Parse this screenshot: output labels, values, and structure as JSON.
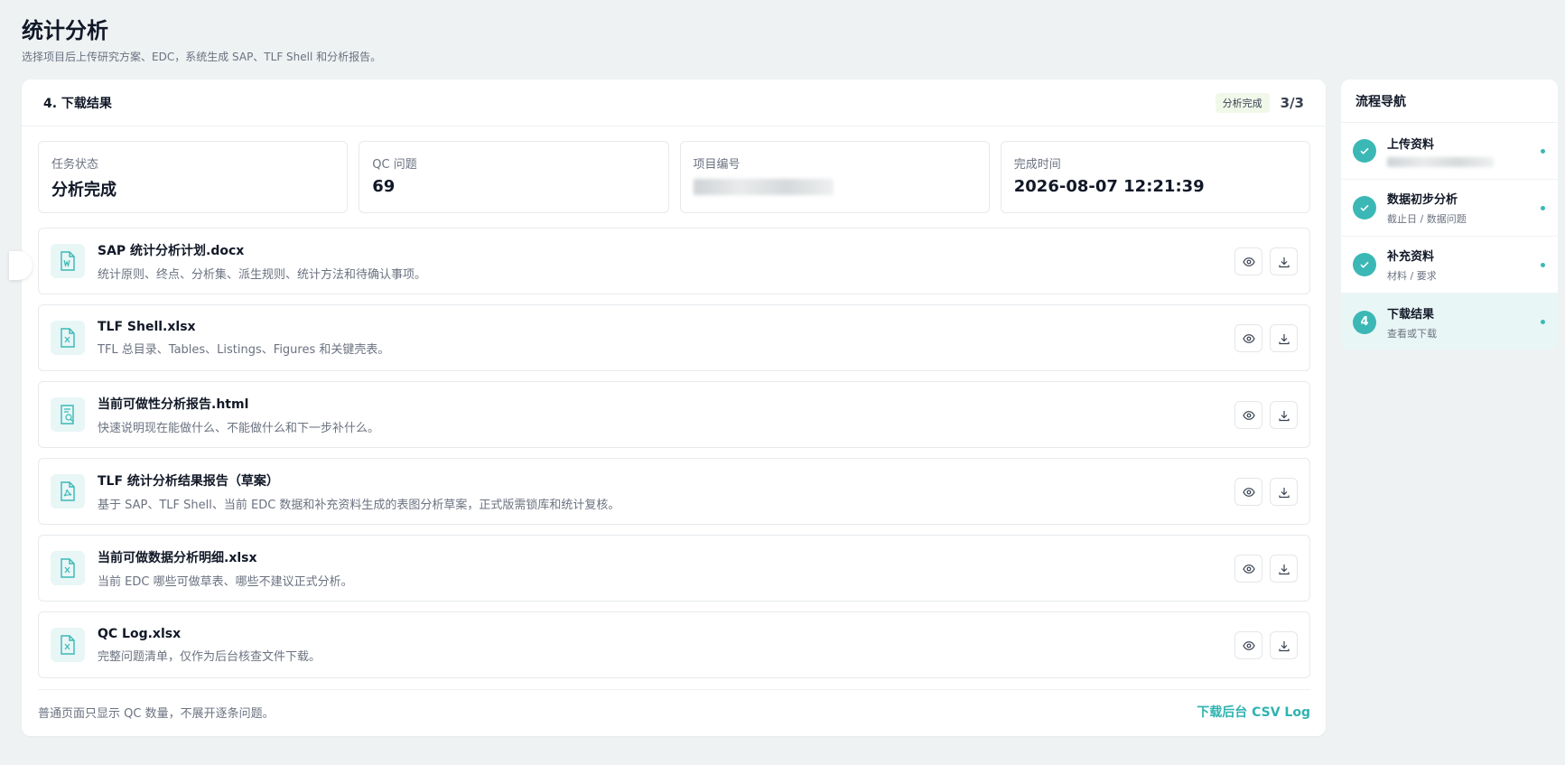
{
  "page": {
    "title": "统计分析",
    "subtitle": "选择项目后上传研究方案、EDC，系统生成 SAP、TLF Shell 和分析报告。"
  },
  "card": {
    "step_title": "4. 下载结果",
    "badge": "分析完成",
    "progress": "3/3"
  },
  "stats": [
    {
      "label": "任务状态",
      "value": "分析完成"
    },
    {
      "label": "QC 问题",
      "value": "69"
    },
    {
      "label": "项目编号",
      "value": ""
    },
    {
      "label": "完成时间",
      "value": "2026-08-07 12:21:39"
    }
  ],
  "files": [
    {
      "name": "SAP 统计分析计划.docx",
      "desc": "统计原则、终点、分析集、派生规则、统计方法和待确认事项。",
      "icon": "word-file-icon"
    },
    {
      "name": "TLF Shell.xlsx",
      "desc": "TFL 总目录、Tables、Listings、Figures 和关键壳表。",
      "icon": "excel-file-icon"
    },
    {
      "name": "当前可做性分析报告.html",
      "desc": "快速说明现在能做什么、不能做什么和下一步补什么。",
      "icon": "report-search-icon"
    },
    {
      "name": "TLF 统计分析结果报告（草案）",
      "desc": "基于 SAP、TLF Shell、当前 EDC 数据和补充资料生成的表图分析草案，正式版需锁库和统计复核。",
      "icon": "pdf-file-icon"
    },
    {
      "name": "当前可做数据分析明细.xlsx",
      "desc": "当前 EDC 哪些可做草表、哪些不建议正式分析。",
      "icon": "excel-file-icon"
    },
    {
      "name": "QC Log.xlsx",
      "desc": "完整问题清单，仅作为后台核查文件下载。",
      "icon": "excel-file-icon"
    }
  ],
  "footer": {
    "note": "普通页面只显示 QC 数量，不展开逐条问题。",
    "link": "下载后台 CSV Log"
  },
  "nav": {
    "title": "流程导航",
    "items": [
      {
        "label": "上传资料",
        "sub": "",
        "marker": "check"
      },
      {
        "label": "数据初步分析",
        "sub": "截止日 / 数据问题",
        "marker": "check"
      },
      {
        "label": "补充资料",
        "sub": "材料 / 要求",
        "marker": "check"
      },
      {
        "label": "下载结果",
        "sub": "查看或下载",
        "marker": "4"
      }
    ]
  },
  "colors": {
    "accent": "#3bb8b6",
    "background": "#eef2f3"
  }
}
